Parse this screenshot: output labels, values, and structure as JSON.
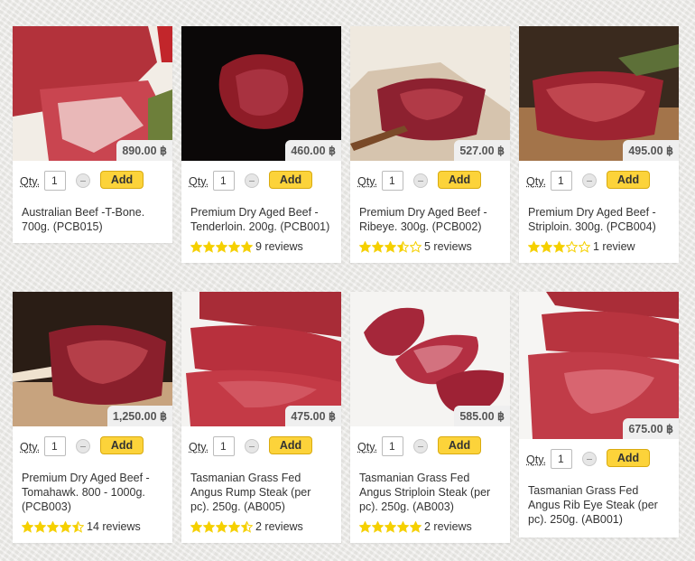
{
  "qty_label": "Qty.",
  "add_label": "Add",
  "products": [
    {
      "title": "Australian Beef -T-Bone. 700g. (PCB015)",
      "price": "890.00 ฿",
      "qty": "1",
      "rating": null,
      "reviews": ""
    },
    {
      "title": "Premium Dry Aged Beef - Tenderloin. 200g. (PCB001)",
      "price": "460.00 ฿",
      "qty": "1",
      "rating": 5,
      "reviews": "9 reviews"
    },
    {
      "title": "Premium Dry Aged Beef - Ribeye. 300g. (PCB002)",
      "price": "527.00 ฿",
      "qty": "1",
      "rating": 3.5,
      "reviews": "5 reviews"
    },
    {
      "title": "Premium Dry Aged Beef - Striploin. 300g. (PCB004)",
      "price": "495.00 ฿",
      "qty": "1",
      "rating": 3,
      "reviews": "1 review"
    },
    {
      "title": "Premium Dry Aged Beef - Tomahawk. 800 - 1000g. (PCB003)",
      "price": "1,250.00 ฿",
      "qty": "1",
      "rating": 4.5,
      "reviews": "14 reviews"
    },
    {
      "title": "Tasmanian Grass Fed Angus Rump Steak (per pc). 250g. (AB005)",
      "price": "475.00 ฿",
      "qty": "1",
      "rating": 4.5,
      "reviews": "2 reviews"
    },
    {
      "title": "Tasmanian Grass Fed Angus Striploin Steak (per pc). 250g. (AB003)",
      "price": "585.00 ฿",
      "qty": "1",
      "rating": 5,
      "reviews": "2 reviews"
    },
    {
      "title": "Tasmanian Grass Fed Angus Rib Eye Steak (per pc). 250g. (AB001)",
      "price": "675.00 ฿",
      "qty": "1",
      "rating": null,
      "reviews": ""
    }
  ],
  "colors": {
    "star": "#f5d000",
    "add_button": "#fcd33a",
    "price_tag": "#efefef"
  }
}
